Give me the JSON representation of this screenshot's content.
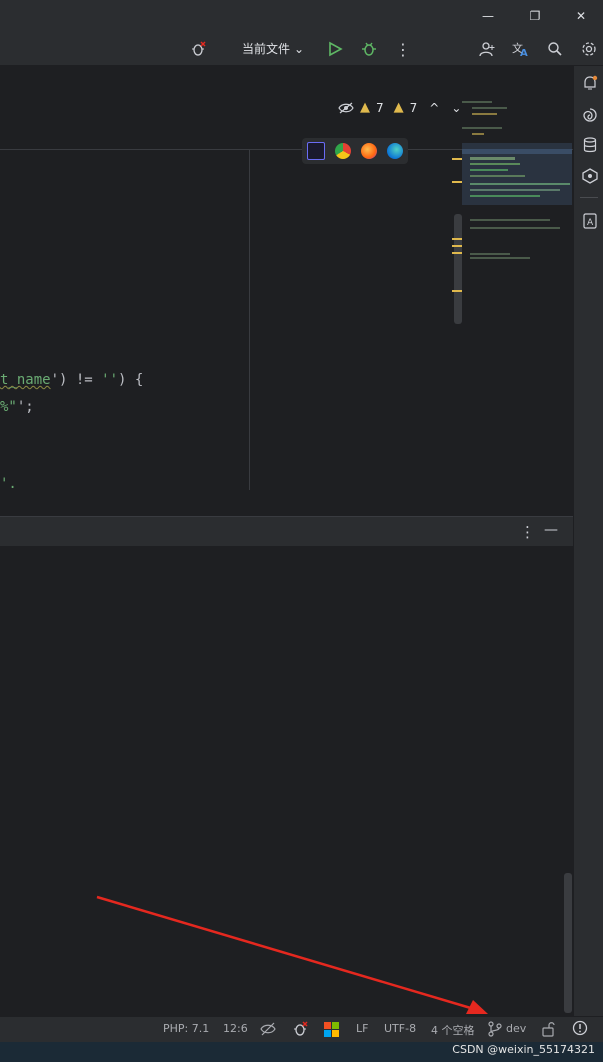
{
  "window_controls": {
    "minimize": "—",
    "restore": "❐",
    "close": "✕"
  },
  "toolbar": {
    "run_config_label": "当前文件",
    "run_config_chevron": "⌄",
    "more_label": "⋮",
    "icons": [
      "bug-disabled-icon",
      "run-icon",
      "debug-icon",
      "more-icon",
      "add-user-icon",
      "translate-icon",
      "search-icon",
      "settings-icon"
    ]
  },
  "inspection": {
    "error_count": "7",
    "warning_count": "7",
    "up": "^",
    "down": "⌄"
  },
  "editor": {
    "lines": [
      {
        "part1": "t_name",
        "part2": "') != ",
        "part3": "''",
        "part4": ") {"
      },
      {
        "part1": "%\"",
        "part2": "';"
      },
      {
        "part1": "'."
      }
    ]
  },
  "tool_window": {
    "more_label": "⋮",
    "minimize_label": "—"
  },
  "status": {
    "language": "PHP: 7.1",
    "caret": "12:6",
    "line_sep": "LF",
    "encoding": "UTF-8",
    "indent": "4 个空格",
    "branch": "dev"
  },
  "watermark": "CSDN @weixin_55174321",
  "colors": {
    "accent_green": "#5fb865",
    "warn": "#e0b94d",
    "arrow": "#e5281f"
  }
}
